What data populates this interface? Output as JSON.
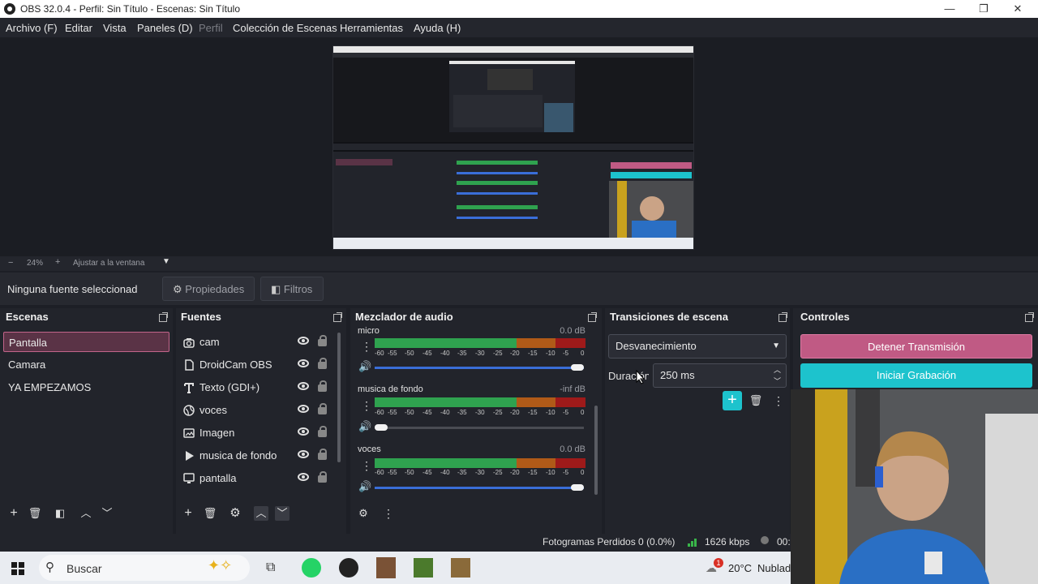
{
  "window": {
    "title": "OBS 32.0.4 - Perfil: Sin Título - Escenas: Sin Título"
  },
  "menu": {
    "items": [
      "Archivo (F)",
      "Editar",
      "Vista",
      "Paneles (D)",
      "Perfil",
      "Colección de Escenas",
      "Herramientas",
      "Ayuda (H)"
    ]
  },
  "zoom": {
    "minus": "−",
    "level": "24%",
    "plus": "+",
    "fit_label": "Ajustar a la ventana"
  },
  "source_toolbar": {
    "no_source": "Ninguna fuente seleccionad",
    "properties": "Propiedades",
    "filters": "Filtros"
  },
  "scenes": {
    "title": "Escenas",
    "items": [
      "Pantalla",
      "Camara",
      "YA EMPEZAMOS"
    ],
    "selected": "Pantalla"
  },
  "sources": {
    "title": "Fuentes",
    "items": [
      {
        "label": "cam",
        "icon": "camera-icon"
      },
      {
        "label": "DroidCam OBS",
        "icon": "file-icon"
      },
      {
        "label": "Texto (GDI+)",
        "icon": "text-icon"
      },
      {
        "label": "voces",
        "icon": "globe-icon"
      },
      {
        "label": "Imagen",
        "icon": "image-icon"
      },
      {
        "label": "musica de fondo",
        "icon": "play-icon"
      },
      {
        "label": "pantalla",
        "icon": "monitor-icon"
      }
    ]
  },
  "mixer": {
    "title": "Mezclador de audio",
    "scale_labels": [
      "-60",
      "-55",
      "-50",
      "-45",
      "-40",
      "-35",
      "-30",
      "-25",
      "-20",
      "-15",
      "-10",
      "-5",
      "0"
    ],
    "channels": [
      {
        "name": "micro",
        "db": "0.0 dB",
        "volume": 1.0
      },
      {
        "name": "musica de fondo",
        "db": "-inf dB",
        "volume": 0.0
      },
      {
        "name": "voces",
        "db": "0.0 dB",
        "volume": 1.0
      }
    ]
  },
  "transitions": {
    "title": "Transiciones de escena",
    "selected": "Desvanecimiento",
    "duration_label": "Duración",
    "duration_value": "250 ms"
  },
  "controls": {
    "title": "Controles",
    "stop_stream": "Detener Transmisión",
    "start_record": "Iniciar Grabación"
  },
  "status": {
    "dropped": "Fotogramas Perdidos 0 (0.0%)",
    "bitrate": "1626 kbps",
    "time_fragment": "00:"
  },
  "taskbar": {
    "search_placeholder": "Buscar",
    "temperature": "20°C",
    "weather": "Nublad",
    "notification_count": "1"
  },
  "colors": {
    "stop_stream_bg": "#c05a84",
    "start_record_bg": "#1dc3cd",
    "selected_scene_bg": "#5a3346",
    "accent_plus": "#1dc3cd"
  }
}
